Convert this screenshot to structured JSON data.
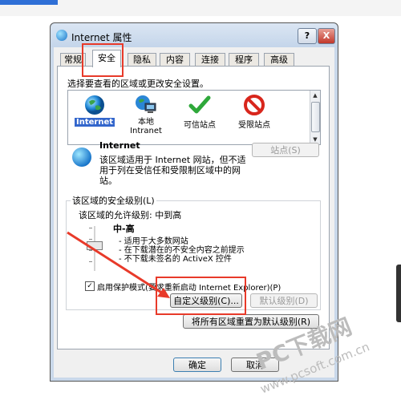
{
  "dialog": {
    "title": "Internet 属性",
    "help_label": "?",
    "close_label": "X"
  },
  "tabs": [
    "常规",
    "安全",
    "隐私",
    "内容",
    "连接",
    "程序",
    "高级"
  ],
  "security": {
    "section_label": "选择要查看的区域或更改安全设置。",
    "zones": [
      {
        "label": "Internet",
        "icon": "globe-icon"
      },
      {
        "label": "本地\nIntranet",
        "icon": "local-intranet-icon"
      },
      {
        "label": "可信站点",
        "icon": "checkmark-icon"
      },
      {
        "label": "受限站点",
        "icon": "no-entry-icon"
      }
    ],
    "zone_title": "Internet",
    "zone_desc": "该区域适用于 Internet 网站，但不适用于列在受信任和受限制区域中的网站。",
    "sites_button": "站点(S)",
    "group_label": "该区域的安全级别(L)",
    "allowed_level": "该区域的允许级别: 中到高",
    "level_name": "中-高",
    "level_details": [
      "- 适用于大多数网站",
      "- 在下载潜在的不安全内容之前提示",
      "- 不下载未签名的 ActiveX 控件"
    ],
    "protected_mode_label": "启用保护模式(要求重新启动 Internet Explorer)(P)",
    "protected_mode_checked": true,
    "custom_level_button": "自定义级别(C)...",
    "default_level_button": "默认级别(D)",
    "reset_all_button": "将所有区域重置为默认级别(R)"
  },
  "footer": {
    "ok": "确定",
    "cancel": "取消"
  },
  "watermark": {
    "text": "PC下载网",
    "url": "www.pcsoft.com.cn"
  },
  "colors": {
    "highlight": "#e83a2a",
    "selection": "#3366cc"
  }
}
